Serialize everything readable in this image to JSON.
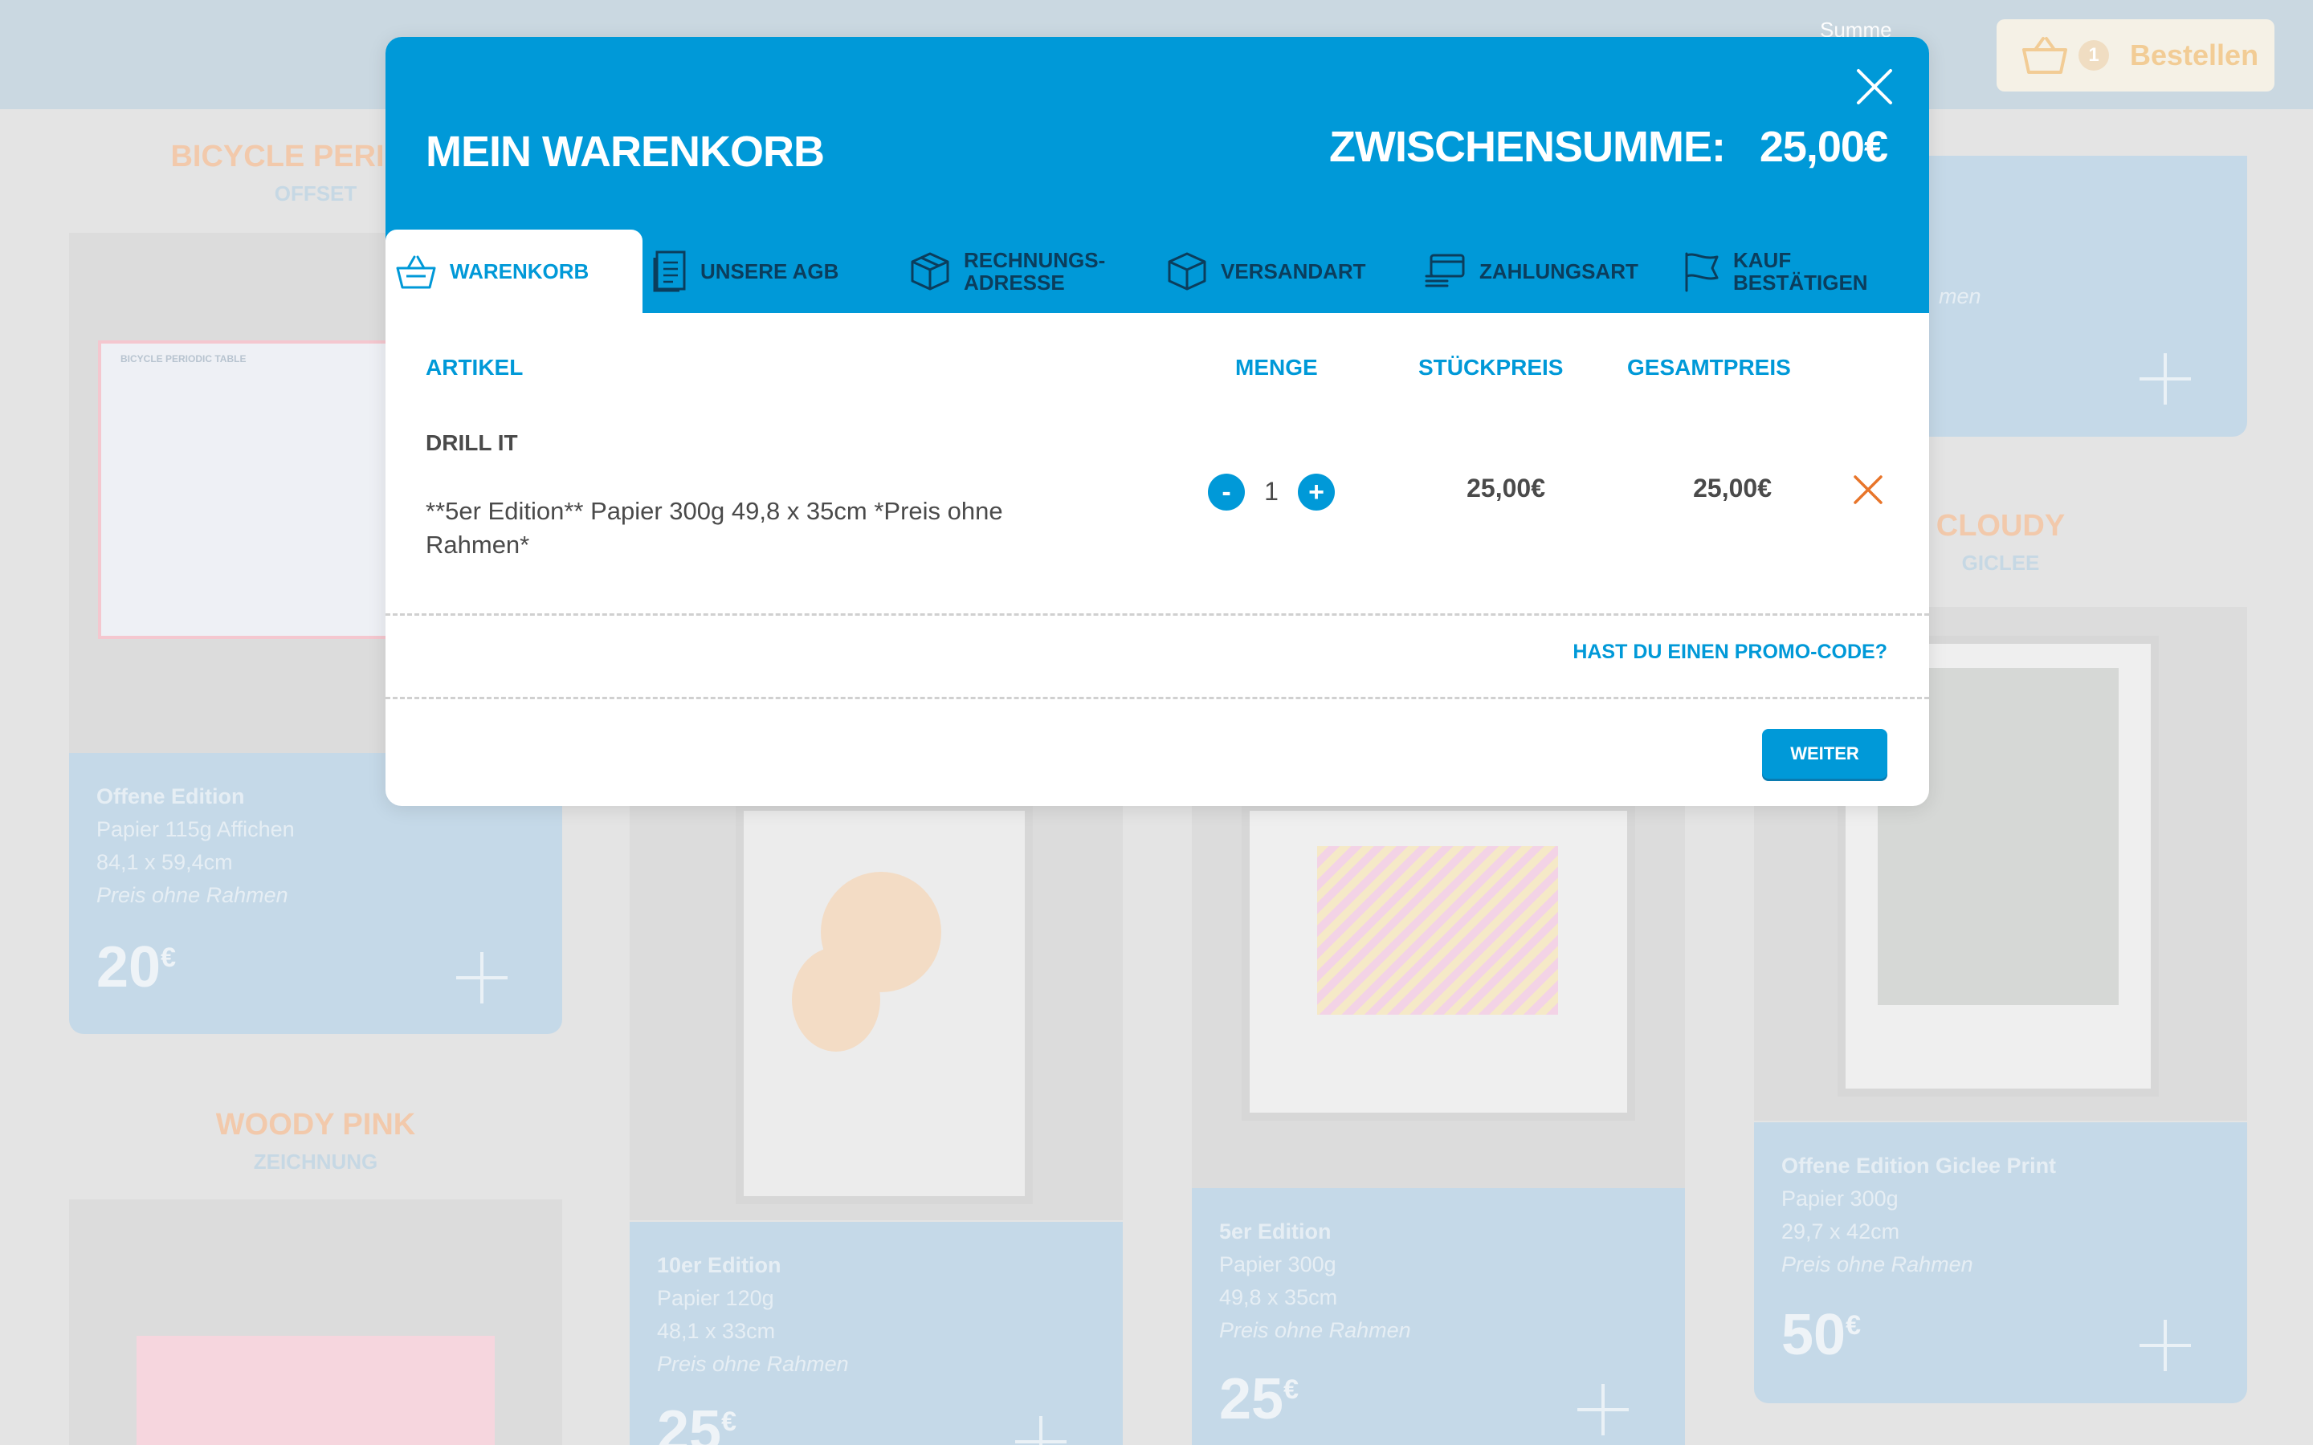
{
  "header": {
    "summe_label": "Summe",
    "summe_value": "€",
    "cart_count": "1",
    "order_label": "Bestellen"
  },
  "products": [
    {
      "title": "BICYCLE PERIODIC",
      "subtitle": "OFFSET",
      "poster_caption": "BICYCLE PERIODIC TABLE",
      "info": [
        "Offene Edition",
        "Papier 115g Affichen",
        "84,1 x 59,4cm",
        "Preis ohne Rahmen"
      ],
      "price": "20",
      "currency": "€"
    },
    {
      "title": "WOODY PINK",
      "subtitle": "ZEICHNUNG"
    },
    {
      "info": [
        "10er Edition",
        "Papier 120g",
        "48,1 x 33cm",
        "Preis ohne Rahmen"
      ],
      "price": "25",
      "currency": "€"
    },
    {
      "info": [
        "5er Edition",
        "Papier 300g",
        "49,8 x 35cm",
        "Preis ohne Rahmen"
      ],
      "price": "25",
      "currency": "€"
    },
    {
      "info_partial": "men"
    },
    {
      "title": "CLOUDY",
      "subtitle": "GICLEE",
      "info": [
        "Offene Edition Giclee Print",
        "Papier 300g",
        "29,7 x 42cm",
        "Preis ohne Rahmen"
      ],
      "price": "50",
      "currency": "€"
    }
  ],
  "modal": {
    "title": "MEIN WARENKORB",
    "subtotal_label": "ZWISCHENSUMME:",
    "subtotal_value": "25,00€",
    "tabs": [
      {
        "label": "WARENKORB",
        "icon": "basket-icon"
      },
      {
        "label": "UNSERE AGB",
        "icon": "document-icon"
      },
      {
        "label": "RECHNUNGS-\nADRESSE",
        "icon": "box-icon"
      },
      {
        "label": "VERSANDART",
        "icon": "box-icon"
      },
      {
        "label": "ZAHLUNGSART",
        "icon": "card-icon"
      },
      {
        "label": "KAUF\nBESTÄTIGEN",
        "icon": "flag-icon"
      }
    ],
    "columns": {
      "article": "ARTIKEL",
      "quantity": "MENGE",
      "unit_price": "STÜCKPREIS",
      "total": "GESAMTPREIS"
    },
    "item": {
      "name": "DRILL IT",
      "description": "**5er Edition** Papier 300g 49,8 x 35cm *Preis ohne Rahmen*",
      "quantity": "1",
      "minus": "-",
      "plus": "+",
      "unit_price": "25,00€",
      "total": "25,00€"
    },
    "promo_link": "HAST DU EINEN PROMO-CODE?",
    "next_button": "WEITER"
  },
  "colors": {
    "primary": "#0099d8",
    "remove": "#e8752a",
    "overlay_bg": "#e4e4e4"
  }
}
